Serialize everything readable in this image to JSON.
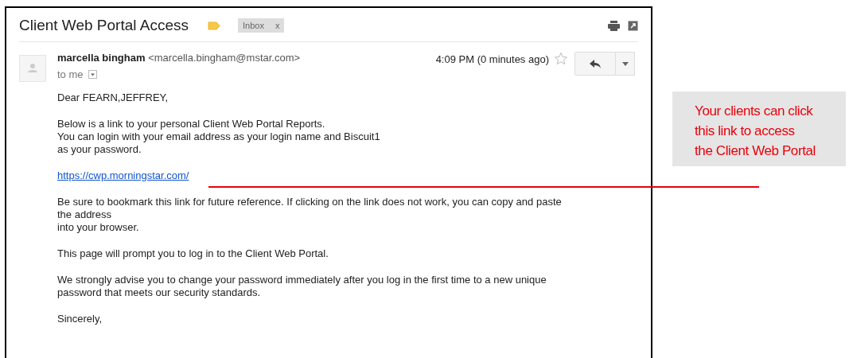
{
  "email": {
    "subject": "Client Web Portal Access",
    "label": "Inbox",
    "label_close": "x",
    "sender_name": "marcella bingham",
    "sender_email": "<marcella.bingham@mstar.com>",
    "recipient": "to me",
    "time": "4:09 PM (0 minutes ago)",
    "starred": false,
    "body": [
      {
        "kind": "text",
        "lines": [
          "Dear FEARN,JEFFREY,"
        ]
      },
      {
        "kind": "text",
        "lines": [
          "Below is a link to your personal Client Web Portal Reports.",
          "You can login with your email address as your login name and Biscuit1",
          "as your password."
        ]
      },
      {
        "kind": "link",
        "lines": [
          "https://cwp.morningstar.com/"
        ]
      },
      {
        "kind": "text",
        "lines": [
          "Be sure to bookmark this link for future reference. If clicking on the link does not work, you can copy and paste",
          "the address",
          "into your browser."
        ]
      },
      {
        "kind": "text",
        "lines": [
          "This page will prompt you to log in to the Client Web Portal."
        ]
      },
      {
        "kind": "text",
        "lines": [
          "We strongly advise you to change your password immediately after you log in the first time to a new unique",
          "password that meets our security standards."
        ]
      },
      {
        "kind": "text",
        "lines": [
          "Sincerely,"
        ]
      }
    ]
  },
  "callout": {
    "lines": [
      "Your clients can click",
      "this link to access",
      "the Client Web Portal"
    ]
  }
}
